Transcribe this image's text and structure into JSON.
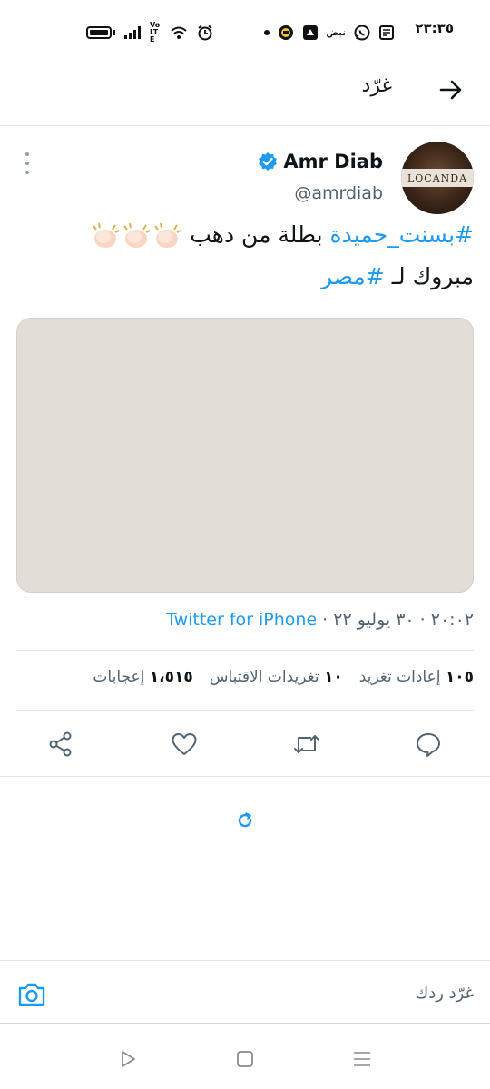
{
  "status_bar": {
    "time": "٢٣:٣٥",
    "pulse_label": "نبض",
    "volte_label": "Vo LTE",
    "icons": [
      "battery-icon",
      "signal-icon",
      "volte-icon",
      "wifi-icon",
      "alarm-icon",
      "notification-dot-icon",
      "app-badge-icon",
      "app-icon",
      "whatsapp-icon",
      "news-icon"
    ]
  },
  "header": {
    "title": "غرّد",
    "back_icon": "arrow-right-icon"
  },
  "tweet": {
    "author_name": "Amr Diab",
    "author_handle": "@amrdiab",
    "avatar_text": "LOCANDA",
    "verified_icon": "verified-badge-icon",
    "line1_hashtag": "#بسنت_حميدة",
    "line1_text": " بطلة من دهب ",
    "line2_text": "مبروك لـ ",
    "line2_hashtag": "#مصر",
    "timestamp": "٢٠:٠٢ · ٣٠ يوليو ٢٢ · ",
    "source": "Twitter for iPhone",
    "stats": {
      "retweets_count": "١٠٥",
      "retweets_label": "إعادات تغريد",
      "quotes_count": "١٠",
      "quotes_label": "تغريدات الاقتباس",
      "likes_count": "١،٥١٥",
      "likes_label": "إعجابات"
    }
  },
  "reply_bar": {
    "placeholder": "غرّد ردك"
  },
  "colors": {
    "accent": "#1d9bf0",
    "text_primary": "#0f1419",
    "text_secondary": "#536471",
    "media_placeholder": "#e2ded7"
  }
}
